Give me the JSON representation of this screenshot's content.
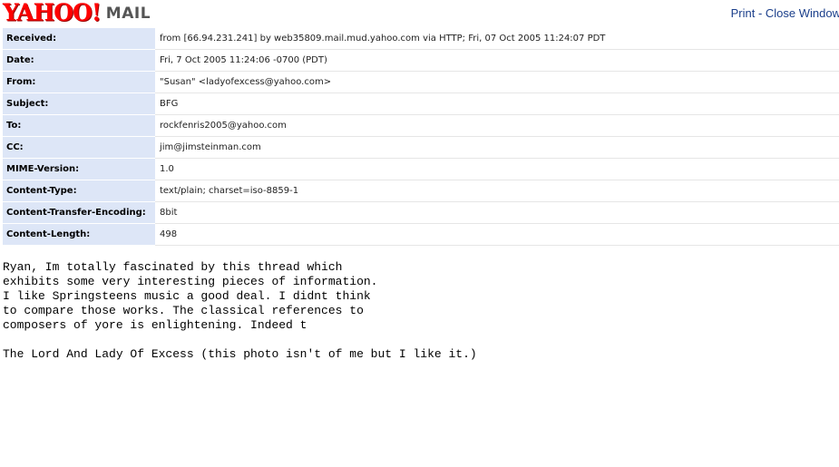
{
  "logo": {
    "brand": "YAHOO!",
    "product": "MAIL",
    "brand_color": "#ff0000",
    "product_color": "#555555"
  },
  "toplinks": {
    "print": "Print",
    "separator": " - ",
    "close": "Close Window",
    "link_color": "#1b3f8b"
  },
  "headers": [
    {
      "name": "Received:",
      "value": "from [66.94.231.241] by web35809.mail.mud.yahoo.com via HTTP; Fri, 07 Oct 2005 11:24:07 PDT"
    },
    {
      "name": "Date:",
      "value": "Fri, 7 Oct 2005 11:24:06 -0700 (PDT)"
    },
    {
      "name": "From:",
      "value": "\"Susan\" <ladyofexcess@yahoo.com>"
    },
    {
      "name": "Subject:",
      "value": "BFG"
    },
    {
      "name": "To:",
      "value": "rockfenris2005@yahoo.com"
    },
    {
      "name": "CC:",
      "value": "jim@jimsteinman.com"
    },
    {
      "name": "MIME-Version:",
      "value": "1.0"
    },
    {
      "name": "Content-Type:",
      "value": "text/plain; charset=iso-8859-1"
    },
    {
      "name": "Content-Transfer-Encoding:",
      "value": "8bit"
    },
    {
      "name": "Content-Length:",
      "value": "498"
    }
  ],
  "header_label_bg": "#dde6f7",
  "body_lines": [
    "Ryan, Im totally fascinated by this thread which",
    "exhibits some very interesting pieces of information.",
    "I like Springsteens music a good deal. I didnt think",
    "to compare those works. The classical references to",
    "composers of yore is enlightening. Indeed t",
    "",
    "The Lord And Lady Of Excess (this photo isn't of me but I like it.)"
  ]
}
